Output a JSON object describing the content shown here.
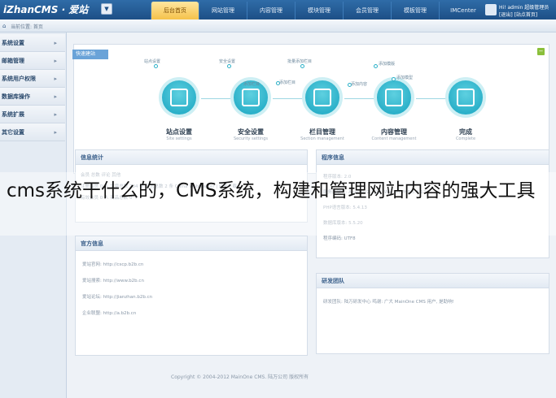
{
  "app": {
    "logo": "iZhanCMS · 爱站",
    "logo_dropdown": "▼"
  },
  "topnav": [
    {
      "label": "后台首页",
      "active": true
    },
    {
      "label": "网站管理",
      "active": false
    },
    {
      "label": "内容管理",
      "active": false
    },
    {
      "label": "模块管理",
      "active": false
    },
    {
      "label": "会员管理",
      "active": false
    },
    {
      "label": "模板管理",
      "active": false
    },
    {
      "label": "IMCenter",
      "active": false
    }
  ],
  "user": {
    "line1": "Hi! admin 超级管理员",
    "line2": "[退出] [站点首页]"
  },
  "breadcrumb": {
    "home_icon": "⌂",
    "text": "当前位置: 首页"
  },
  "sidebar": [
    {
      "label": "系统设置",
      "arrow": "▸"
    },
    {
      "label": "邮箱管理",
      "arrow": "▸"
    },
    {
      "label": "系统用户权限",
      "arrow": "▸"
    },
    {
      "label": "数据库操作",
      "arrow": "▸"
    },
    {
      "label": "系统扩展",
      "arrow": "▸"
    },
    {
      "label": "其它设置",
      "arrow": "▸"
    }
  ],
  "welcome": {
    "ribbon": "快速建站",
    "minimize": "−",
    "steps": [
      {
        "title": "站点设置",
        "sub": "Site settings"
      },
      {
        "title": "安全设置",
        "sub": "Security settings"
      },
      {
        "title": "栏目管理",
        "sub": "Section management"
      },
      {
        "title": "内容管理",
        "sub": "Content management"
      },
      {
        "title": "完成",
        "sub": "Complete"
      }
    ],
    "flow_labels": [
      "站点设置",
      "安全设置",
      "批量添加栏目",
      "添加栏目",
      "添加模版",
      "添加模型",
      "添加内容",
      "添加栏目"
    ]
  },
  "stats_panel": {
    "title": "信息统计",
    "rows": [
      "会员   总数   评论   其他",
      "注册会员 0 人   文章总数 204 条   留言总数 2 条   China Webmaster | 站长下载",
      "有效会员 0 人   商品总数 0 个"
    ]
  },
  "program_panel": {
    "title": "程序信息",
    "rows": [
      "程序版本: 2.0",
      "服务器软件: Apache/2.2.22 (Win32) PHP/5.4.13",
      "PHP语言版本: 5.4.13",
      "数据库版本: 5.5.20",
      "程序编码: UTF8"
    ]
  },
  "official_panel": {
    "title": "官方信息",
    "rows": [
      "爱站官网: http://cscp.b2b.cn",
      "爱站搜索: http://www.b2b.cn",
      "爱站论坛: http://jianzhan.b2b.cn",
      "企业联盟: http://a.b2b.cn"
    ]
  },
  "dev_panel": {
    "title": "研发团队",
    "row": "研发团队: 陆万研发中心     鸣谢: 广大 MainOne CMS 用户, 是助响!"
  },
  "footer": "Copyright © 2004-2012 MainOne CMS. 陆万公司 版权所有",
  "caption": "cms系统干什么的，CMS系统，构建和管理网站内容的强大工具",
  "colors": {
    "topbar": "#1d4f86",
    "step": "#17a4c0",
    "active_tab": "#f5c24a"
  }
}
